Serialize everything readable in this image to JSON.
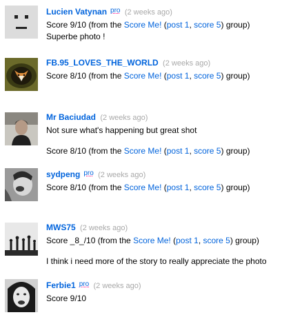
{
  "comments": [
    {
      "user": "Lucien Vatynan",
      "pro": "pro",
      "time": "(2 weeks ago)",
      "score": {
        "prefix": "Score 9/10 (from the ",
        "group": "Score Me!",
        "open": " (",
        "post": "post 1",
        "sep": ", ",
        "score": "score 5",
        "close": ")",
        "suffix": " group)"
      },
      "text": "Superbe photo !"
    },
    {
      "user": "FB.95_LOVES_THE_WORLD",
      "time": "(2 weeks ago)",
      "score": {
        "prefix": "Score 8/10 (from the ",
        "group": "Score Me!",
        "open": " (",
        "post": "post 1",
        "sep": ", ",
        "score": "score 5",
        "close": ")",
        "suffix": " group)"
      }
    },
    {
      "user": "Mr Baciudad",
      "time": "(2 weeks ago)",
      "text": "Not sure what's happening but great shot",
      "score": {
        "prefix": "Score 8/10 (from the ",
        "group": "Score Me!",
        "open": " (",
        "post": "post 1",
        "sep": ", ",
        "score": "score 5",
        "close": ")",
        "suffix": " group)"
      }
    },
    {
      "user": "sydpeng",
      "pro": "pro",
      "time": "(2 weeks ago)",
      "score": {
        "prefix": "Score 8/10 (from the ",
        "group": "Score Me!",
        "open": " (",
        "post": "post 1",
        "sep": ", ",
        "score": "score 5",
        "close": ")",
        "suffix": " group)"
      }
    },
    {
      "user": "MWS75",
      "time": "(2 weeks ago)",
      "score": {
        "prefix": "Score _8_/10 (from the ",
        "group": "Score Me!",
        "open": " (",
        "post": "post 1",
        "sep": ", ",
        "score": "score 5",
        "close": ")",
        "suffix": " group)"
      },
      "text": "I think i need more of the story to really appreciate the photo"
    },
    {
      "user": "Ferbie1",
      "pro": "pro",
      "time": "(2 weeks ago)",
      "text": "Score 9/10"
    }
  ]
}
